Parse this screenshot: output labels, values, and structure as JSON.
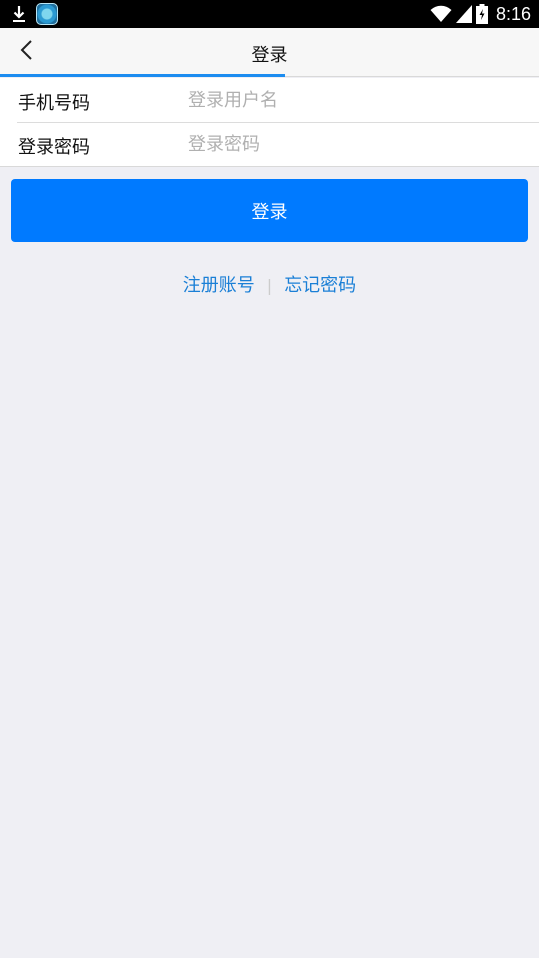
{
  "status_bar": {
    "time": "8:16",
    "icons": [
      "download-icon",
      "app-icon",
      "wifi-icon",
      "signal-icon",
      "battery-icon"
    ]
  },
  "nav": {
    "title": "登录",
    "back_icon": "chevron-left-icon"
  },
  "form": {
    "phone": {
      "label": "手机号码",
      "placeholder": "登录用户名",
      "value": ""
    },
    "password": {
      "label": "登录密码",
      "placeholder": "登录密码",
      "value": ""
    }
  },
  "actions": {
    "login_label": "登录",
    "register_label": "注册账号",
    "separator": "|",
    "forgot_label": "忘记密码"
  },
  "colors": {
    "primary": "#007aff",
    "link": "#1a7fd6",
    "background": "#efeff4",
    "progress": "#1c8cf0"
  }
}
